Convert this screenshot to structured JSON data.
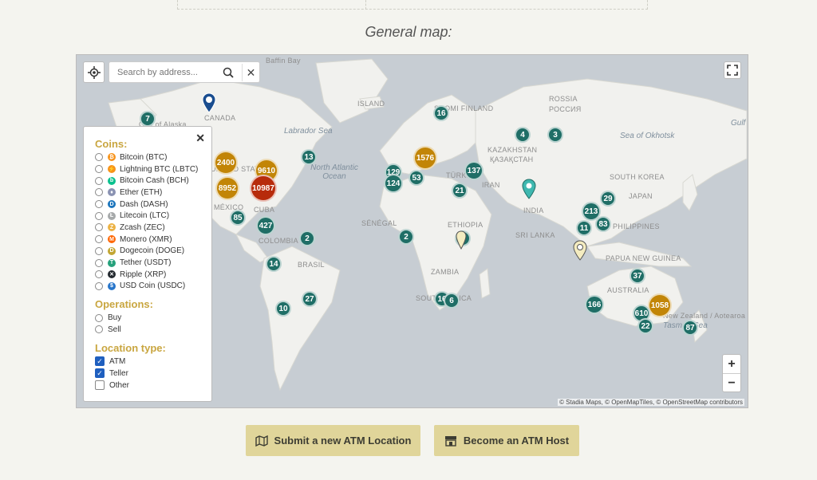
{
  "page": {
    "title": "General map:"
  },
  "search": {
    "placeholder": "Search by address..."
  },
  "filters": {
    "coins_title": "Coins:",
    "coins": [
      {
        "label": "Bitcoin (BTC)",
        "color": "#f7931a",
        "glyph": "₿"
      },
      {
        "label": "Lightning BTC (LBTC)",
        "color": "#f7931a",
        "glyph": "⚡"
      },
      {
        "label": "Bitcoin Cash (BCH)",
        "color": "#0ac18e",
        "glyph": "b"
      },
      {
        "label": "Ether (ETH)",
        "color": "#8a92b2",
        "glyph": "♦"
      },
      {
        "label": "Dash (DASH)",
        "color": "#1c75bc",
        "glyph": "D"
      },
      {
        "label": "Litecoin (LTC)",
        "color": "#a6a9aa",
        "glyph": "Ł"
      },
      {
        "label": "Zcash (ZEC)",
        "color": "#ecb244",
        "glyph": "Z"
      },
      {
        "label": "Monero (XMR)",
        "color": "#ff6600",
        "glyph": "M"
      },
      {
        "label": "Dogecoin (DOGE)",
        "color": "#c2a633",
        "glyph": "D"
      },
      {
        "label": "Tether (USDT)",
        "color": "#26a17b",
        "glyph": "T"
      },
      {
        "label": "Ripple (XRP)",
        "color": "#23292f",
        "glyph": "✕"
      },
      {
        "label": "USD Coin (USDC)",
        "color": "#2775ca",
        "glyph": "$"
      }
    ],
    "operations_title": "Operations:",
    "operations": [
      {
        "label": "Buy"
      },
      {
        "label": "Sell"
      }
    ],
    "location_title": "Location type:",
    "locations": [
      {
        "label": "ATM",
        "checked": true
      },
      {
        "label": "Teller",
        "checked": true
      },
      {
        "label": "Other",
        "checked": false
      }
    ]
  },
  "map_labels": {
    "land": [
      "Baffin Bay",
      "ISLAND",
      "SUOMI FINLAND",
      "ROSSIA",
      "РОССИЯ",
      "KAZAKHSTAN",
      "ҚАЗАҚСТАН",
      "TÜRKIYE",
      "IRAN",
      "INDIA",
      "SRI LANKA",
      "SÉNÉGAL",
      "ETHIOPIA",
      "ZAMBIA",
      "SOUTH AFRICA",
      "AUSTRALIA",
      "PAPUA NEW GUINEA",
      "SOUTH KOREA",
      "JAPAN",
      "PHILIPPINES",
      "CANADA",
      "UNITED STATES",
      "MÉXICO",
      "CUBA",
      "COLOMBIA",
      "BRASIL",
      "Gulf of Alaska",
      "New Zealand / Aotearoa"
    ],
    "ocean": [
      "Labrador Sea",
      "North Atlantic Ocean",
      "Sea of Okhotsk",
      "Tasman Sea",
      "Gulf"
    ]
  },
  "clusters": [
    {
      "count": "7",
      "type": "teal"
    },
    {
      "count": "2400",
      "type": "gold"
    },
    {
      "count": "9610",
      "type": "gold"
    },
    {
      "count": "8952",
      "type": "gold"
    },
    {
      "count": "10987",
      "type": "red"
    },
    {
      "count": "13",
      "type": "teal"
    },
    {
      "count": "85",
      "type": "teal"
    },
    {
      "count": "427",
      "type": "teal"
    },
    {
      "count": "2",
      "type": "teal"
    },
    {
      "count": "14",
      "type": "teal"
    },
    {
      "count": "27",
      "type": "teal"
    },
    {
      "count": "10",
      "type": "teal"
    },
    {
      "count": "16",
      "type": "teal"
    },
    {
      "count": "4",
      "type": "teal"
    },
    {
      "count": "3",
      "type": "teal"
    },
    {
      "count": "1576",
      "type": "gold"
    },
    {
      "count": "137",
      "type": "teal"
    },
    {
      "count": "129",
      "type": "teal"
    },
    {
      "count": "124",
      "type": "teal"
    },
    {
      "count": "53",
      "type": "teal"
    },
    {
      "count": "21",
      "type": "teal"
    },
    {
      "count": "2",
      "type": "teal"
    },
    {
      "count": "2",
      "type": "teal"
    },
    {
      "count": "16",
      "type": "teal"
    },
    {
      "count": "6",
      "type": "teal"
    },
    {
      "count": "29",
      "type": "teal"
    },
    {
      "count": "213",
      "type": "teal"
    },
    {
      "count": "83",
      "type": "teal"
    },
    {
      "count": "11",
      "type": "teal"
    },
    {
      "count": "37",
      "type": "teal"
    },
    {
      "count": "166",
      "type": "teal"
    },
    {
      "count": "1058",
      "type": "gold"
    },
    {
      "count": "610",
      "type": "teal"
    },
    {
      "count": "22",
      "type": "teal"
    },
    {
      "count": "87",
      "type": "teal"
    }
  ],
  "attribution": "© Stadia Maps, © OpenMapTiles, © OpenStreetMap contributors",
  "zoom": {
    "in": "+",
    "out": "−"
  },
  "actions": {
    "submit": "Submit a new ATM Location",
    "host": "Become an ATM Host"
  }
}
